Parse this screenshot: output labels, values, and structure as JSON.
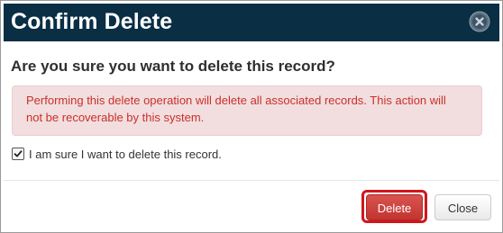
{
  "dialog": {
    "title": "Confirm Delete",
    "close_icon": "close-circle-icon",
    "question": "Are you sure you want to delete this record?",
    "alert_text": "Performing this delete operation will delete all associated records. This action will not be recoverable by this system.",
    "checkbox": {
      "label": "I am sure I want to delete this record.",
      "checked": true
    },
    "buttons": {
      "delete_label": "Delete",
      "close_label": "Close"
    }
  },
  "colors": {
    "header_bg": "#0a2e44",
    "alert_bg": "#f2dede",
    "alert_text": "#c9302c",
    "delete_button": "#d9534f",
    "highlight_outline": "#d0161d"
  }
}
